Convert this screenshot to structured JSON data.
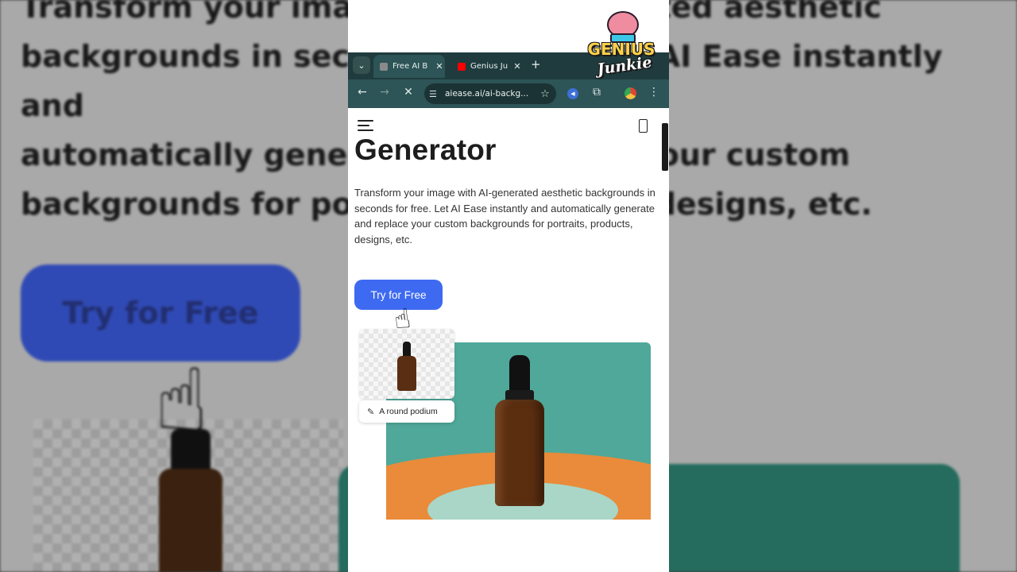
{
  "background": {
    "text": "Transform your image with AI-generated aesthetic\nbackgrounds in seconds for free. Let AI Ease instantly and\nautomatically generate and replace your custom\nbackgrounds for portraits, products, designs, etc.",
    "button_label": "Try for Free"
  },
  "browser": {
    "tabs": [
      {
        "title": "Free AI B",
        "active": true,
        "favicon_color": "#8a8a8a"
      },
      {
        "title": "Genius Ju",
        "active": false,
        "favicon_color": "#ff0000"
      }
    ],
    "new_tab": "+",
    "url": "aiease.ai/ai-backg...",
    "icons": {
      "tab_list": "chevron-down-icon",
      "back": "back-arrow-icon",
      "forward": "forward-arrow-icon",
      "reload": "stop-loading-icon",
      "site_info": "tune-icon",
      "bookmark": "star-icon",
      "extensions": "puzzle-icon",
      "menu": "kebab-menu-icon"
    },
    "colors": {
      "tabbar": "#1f3b3d",
      "toolbar": "#2d5456"
    }
  },
  "page": {
    "heading": "Generator",
    "description": "Transform your image with AI-generated aesthetic backgrounds in seconds for free. Let AI Ease instantly and automatically generate and replace your custom backgrounds for portraits, products, designs, etc.",
    "cta_label": "Try for Free",
    "prompt_chip": "A round podium",
    "colors": {
      "cta": "#3d6af0",
      "scene_teal": "#4fa899",
      "scene_orange": "#e98b3a"
    }
  },
  "overlay": {
    "logo_line1": "GENIUS",
    "logo_line2": "Junkie"
  }
}
